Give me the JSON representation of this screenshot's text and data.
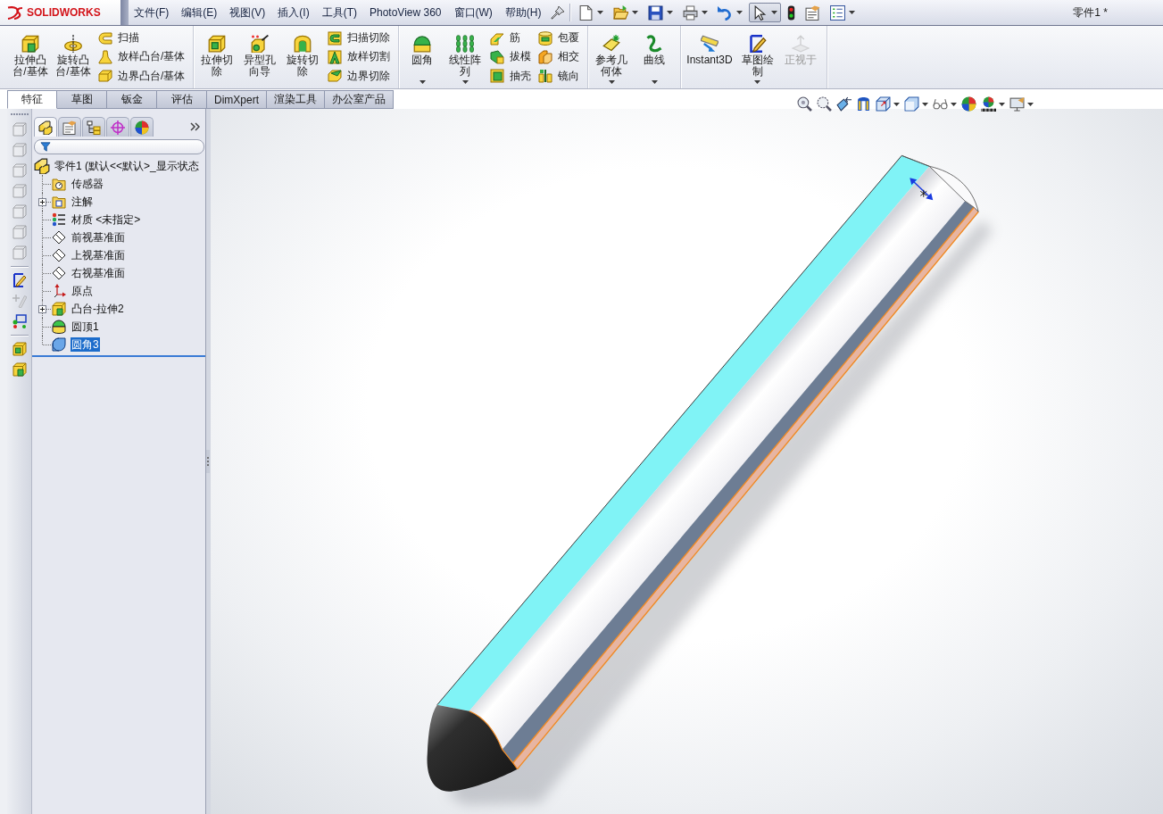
{
  "title_bar": {
    "logo": "SOLIDWORKS",
    "menu": [
      "文件(F)",
      "编辑(E)",
      "视图(V)",
      "插入(I)",
      "工具(T)",
      "PhotoView 360",
      "窗口(W)",
      "帮助(H)"
    ],
    "quick_access": [
      {
        "dropdown": true,
        "pressed": false
      },
      {
        "dropdown": true,
        "pressed": false
      },
      {
        "dropdown": true,
        "pressed": false
      },
      {
        "dropdown": true,
        "pressed": false
      },
      {
        "dropdown": true,
        "pressed": false
      },
      {
        "dropdown": true,
        "pressed": true
      },
      {
        "dropdown": false,
        "pressed": false
      },
      {
        "dropdown": false,
        "pressed": false
      },
      {
        "dropdown": true,
        "pressed": false
      }
    ],
    "document_title": "零件1 *"
  },
  "ribbon": {
    "groups": [
      {
        "items": [
          {
            "kind": "large",
            "label": "拉伸凸台/基体",
            "dropdown": false,
            "disabled": false
          },
          {
            "kind": "large",
            "label": "旋转凸台/基体",
            "dropdown": false,
            "disabled": false
          },
          {
            "kind": "stack",
            "items": [
              {
                "label": "扫描"
              },
              {
                "label": "放样凸台/基体"
              },
              {
                "label": "边界凸台/基体"
              }
            ]
          }
        ]
      },
      {
        "items": [
          {
            "kind": "large",
            "label": "拉伸切除",
            "dropdown": false,
            "disabled": false
          },
          {
            "kind": "large",
            "label": "异型孔向导",
            "dropdown": false,
            "disabled": false
          },
          {
            "kind": "large",
            "label": "旋转切除",
            "dropdown": false,
            "disabled": false
          },
          {
            "kind": "stack",
            "items": [
              {
                "label": "扫描切除"
              },
              {
                "label": "放样切割"
              },
              {
                "label": "边界切除"
              }
            ]
          }
        ]
      },
      {
        "items": [
          {
            "kind": "large",
            "label": "圆角",
            "dropdown": true,
            "disabled": false
          },
          {
            "kind": "large",
            "label": "线性阵列",
            "dropdown": true,
            "disabled": false
          },
          {
            "kind": "stack",
            "items": [
              {
                "label": "筋"
              },
              {
                "label": "拔模"
              },
              {
                "label": "抽壳"
              }
            ]
          },
          {
            "kind": "stack",
            "items": [
              {
                "label": "包覆"
              },
              {
                "label": "相交"
              },
              {
                "label": "镜向"
              }
            ]
          }
        ]
      },
      {
        "items": [
          {
            "kind": "large",
            "label": "参考几何体",
            "dropdown": true,
            "disabled": false
          },
          {
            "kind": "large",
            "label": "曲线",
            "dropdown": true,
            "disabled": false
          }
        ]
      },
      {
        "items": [
          {
            "kind": "large",
            "label": "Instant3D",
            "dropdown": false,
            "disabled": false
          },
          {
            "kind": "large",
            "label": "草图绘制",
            "dropdown": true,
            "disabled": false
          },
          {
            "kind": "large",
            "label": "正视于",
            "dropdown": false,
            "disabled": true
          }
        ]
      }
    ]
  },
  "command_tabs": [
    {
      "label": "特征",
      "selected": true
    },
    {
      "label": "草图",
      "selected": false
    },
    {
      "label": "钣金",
      "selected": false
    },
    {
      "label": "评估",
      "selected": false
    },
    {
      "label": "DimXpert",
      "selected": false
    },
    {
      "label": "渲染工具",
      "selected": false
    },
    {
      "label": "办公室产品",
      "selected": false
    }
  ],
  "left_toolbar": {
    "groups": [
      {
        "buttons": [
          {
            "disabled": true
          },
          {
            "disabled": true
          },
          {
            "disabled": true
          },
          {
            "disabled": true
          },
          {
            "disabled": true
          },
          {
            "disabled": true
          },
          {
            "disabled": true
          }
        ]
      },
      {
        "buttons": [
          {
            "disabled": false
          },
          {
            "disabled": true
          },
          {
            "disabled": false
          }
        ]
      },
      {
        "buttons": [
          {
            "disabled": false
          },
          {
            "disabled": false
          }
        ]
      }
    ]
  },
  "feature_manager": {
    "tabs": [
      {
        "selected": true
      },
      {
        "selected": false
      },
      {
        "selected": false
      },
      {
        "selected": false
      },
      {
        "selected": false
      }
    ],
    "tree": {
      "label": "零件1 (默认<<默认>_显示状态",
      "selected": false,
      "children": [
        {
          "label": "传感器",
          "expandable": false,
          "selected": false
        },
        {
          "label": "注解",
          "expandable": true,
          "selected": false
        },
        {
          "label": "材质 <未指定>",
          "expandable": false,
          "selected": false
        },
        {
          "label": "前视基准面",
          "expandable": false,
          "selected": false
        },
        {
          "label": "上视基准面",
          "expandable": false,
          "selected": false
        },
        {
          "label": "右视基准面",
          "expandable": false,
          "selected": false
        },
        {
          "label": "原点",
          "expandable": false,
          "selected": false
        },
        {
          "label": "凸台-拉伸2",
          "expandable": true,
          "selected": false
        },
        {
          "label": "圆顶1",
          "expandable": false,
          "selected": false
        },
        {
          "label": "圆角3",
          "expandable": false,
          "selected": true
        }
      ]
    }
  },
  "heads_up_toolbar": [
    {
      "dropdown": false
    },
    {
      "dropdown": false
    },
    {
      "dropdown": false
    },
    {
      "dropdown": false
    },
    {
      "dropdown": true
    },
    {
      "dropdown": true
    },
    {
      "dropdown": true
    },
    {
      "dropdown": false
    },
    {
      "dropdown": true
    },
    {
      "dropdown": true
    }
  ]
}
